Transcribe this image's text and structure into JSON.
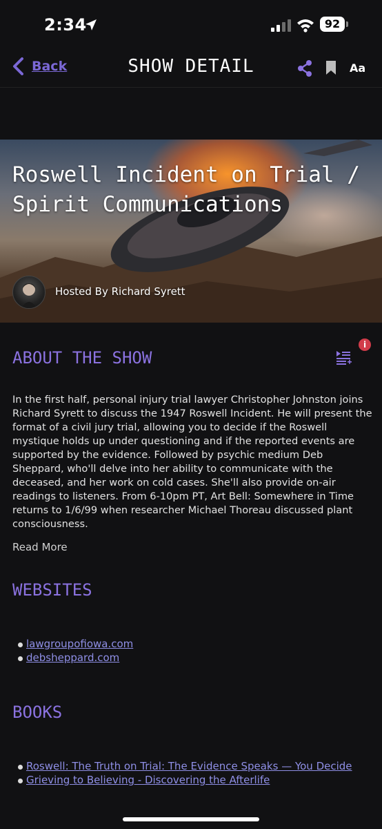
{
  "status_bar": {
    "time": "2:34",
    "battery": "92"
  },
  "nav": {
    "back_label": "Back",
    "title": "SHOW DETAIL",
    "text_size_label": "Aa"
  },
  "show": {
    "title": "Roswell Incident on Trial / Spirit Communications",
    "host_line": "Hosted By Richard Syrett"
  },
  "about": {
    "heading": "ABOUT THE SHOW",
    "info_badge": "i",
    "description": "In the first half, personal injury trial lawyer Christopher Johnston joins Richard Syrett to discuss the 1947 Roswell Incident. He will present the format of a civil jury trial, allowing you to decide if the Roswell mystique holds up under questioning and if the reported events are supported by the evidence. Followed by psychic medium Deb Sheppard, who'll delve into her ability to communicate with the deceased, and her work on cold cases. She'll also provide on-air readings to listeners. From 6-10pm PT, Art Bell: Somewhere in Time returns to 1/6/99 when researcher Michael Thoreau discussed plant consciousness.",
    "read_more": "Read More"
  },
  "websites": {
    "heading": "WEBSITES",
    "items": [
      "lawgroupofiowa.com",
      "debsheppard.com"
    ]
  },
  "books": {
    "heading": "BOOKS",
    "items": [
      "Roswell: The Truth on Trial: The Evidence Speaks — You Decide",
      "Grieving to Believing - Discovering the Afterlife"
    ]
  },
  "colors": {
    "accent": "#8b72e0",
    "link": "#8f8fe6",
    "background": "#111113",
    "badge": "#d23c4a"
  },
  "icons": [
    "location-arrow-icon",
    "signal-icon",
    "wifi-icon",
    "battery-icon",
    "chevron-left-icon",
    "share-icon",
    "bookmark-icon",
    "playlist-add-icon",
    "info-icon"
  ]
}
